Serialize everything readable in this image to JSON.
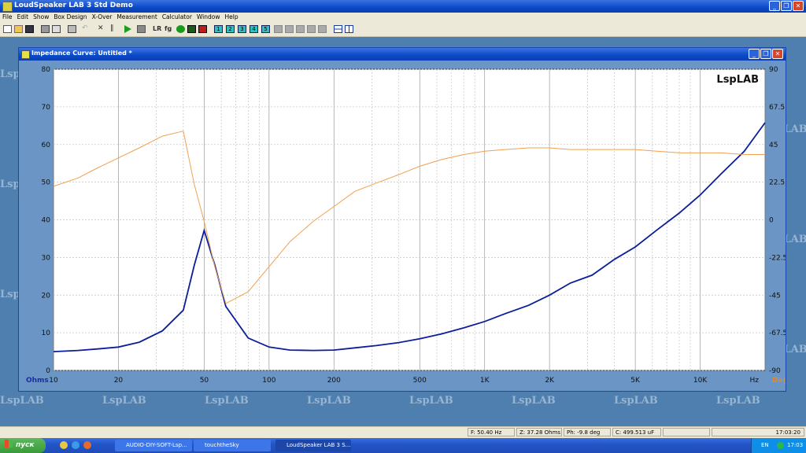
{
  "app": {
    "title": "LoudSpeaker LAB 3 Std Demo",
    "menu": [
      "File",
      "Edit",
      "Show",
      "Box Design",
      "X-Over",
      "Measurement",
      "Calculator",
      "Window",
      "Help"
    ],
    "toolbar_icons": [
      "new-icon",
      "open-icon",
      "save-icon",
      "print-icon",
      "print-preview-icon",
      "copy-icon",
      "undo-icon",
      "tools-icon",
      "sliders-icon",
      "play-icon",
      "stop-icon",
      "lr-icon",
      "fg-icon",
      "green-dot-icon",
      "chart-green-icon",
      "chart-red-icon",
      "num-1-icon",
      "num-2-icon",
      "num-3-icon",
      "num-4-icon",
      "num-5-icon",
      "gray-1-icon",
      "gray-2-icon",
      "gray-3-icon",
      "gray-4-icon",
      "gray-5-icon",
      "gray-6-icon",
      "tile-horizontal-icon",
      "tile-vertical-icon"
    ]
  },
  "window": {
    "title": "Impedance Curve: Untitled *"
  },
  "watermark": "LspLAB",
  "chart_data": {
    "type": "line",
    "title": "LspLAB",
    "xlabel": "Hz",
    "ylabel": "Ohms",
    "y2label": "Deg",
    "x_scale": "log",
    "xlim": [
      10,
      20000
    ],
    "ylim": [
      0,
      80
    ],
    "y2lim": [
      -90,
      90
    ],
    "x_ticks": [
      {
        "v": 10,
        "label": "10"
      },
      {
        "v": 20,
        "label": "20"
      },
      {
        "v": 50,
        "label": "50"
      },
      {
        "v": 100,
        "label": "100"
      },
      {
        "v": 200,
        "label": "200"
      },
      {
        "v": 500,
        "label": "500"
      },
      {
        "v": 1000,
        "label": "1K"
      },
      {
        "v": 2000,
        "label": "2K"
      },
      {
        "v": 5000,
        "label": "5K"
      },
      {
        "v": 10000,
        "label": "10K"
      }
    ],
    "y_ticks": [
      0,
      10,
      20,
      30,
      40,
      50,
      60,
      70,
      80
    ],
    "y2_ticks": [
      "-90",
      "-67.5",
      "-45",
      "-22.5",
      "0",
      "22.5",
      "45",
      "67.5",
      "90"
    ],
    "grid": true,
    "series": [
      {
        "name": "Ohms",
        "color": "#0a1e9a",
        "axis": "left",
        "points": [
          [
            10,
            5
          ],
          [
            13,
            5.3
          ],
          [
            16,
            5.7
          ],
          [
            20,
            6.2
          ],
          [
            25,
            7.5
          ],
          [
            32,
            10.5
          ],
          [
            40,
            16
          ],
          [
            45,
            28
          ],
          [
            50,
            37.2
          ],
          [
            56,
            28
          ],
          [
            63,
            17
          ],
          [
            80,
            8.6
          ],
          [
            100,
            6.2
          ],
          [
            125,
            5.4
          ],
          [
            160,
            5.3
          ],
          [
            200,
            5.4
          ],
          [
            250,
            6
          ],
          [
            315,
            6.6
          ],
          [
            400,
            7.4
          ],
          [
            500,
            8.4
          ],
          [
            630,
            9.7
          ],
          [
            800,
            11.3
          ],
          [
            1000,
            13
          ],
          [
            1250,
            15.1
          ],
          [
            1600,
            17.3
          ],
          [
            2000,
            20
          ],
          [
            2500,
            23.2
          ],
          [
            3150,
            25.3
          ],
          [
            4000,
            29.5
          ],
          [
            5000,
            32.8
          ],
          [
            6300,
            37.3
          ],
          [
            8000,
            41.8
          ],
          [
            10000,
            46.6
          ],
          [
            12500,
            52.2
          ],
          [
            16000,
            58.2
          ],
          [
            20000,
            65.8
          ]
        ]
      },
      {
        "name": "Deg",
        "color": "#f0a050",
        "axis": "right",
        "points": [
          [
            10,
            20
          ],
          [
            13,
            25
          ],
          [
            16,
            31
          ],
          [
            20,
            37
          ],
          [
            25,
            43
          ],
          [
            32,
            50
          ],
          [
            40,
            53
          ],
          [
            45,
            21
          ],
          [
            50,
            -1
          ],
          [
            56,
            -28
          ],
          [
            63,
            -50
          ],
          [
            80,
            -43
          ],
          [
            100,
            -28
          ],
          [
            125,
            -13
          ],
          [
            160,
            -1
          ],
          [
            200,
            8
          ],
          [
            250,
            17
          ],
          [
            315,
            22
          ],
          [
            400,
            27
          ],
          [
            500,
            32
          ],
          [
            630,
            36
          ],
          [
            800,
            39
          ],
          [
            1000,
            41
          ],
          [
            1250,
            42
          ],
          [
            1600,
            43
          ],
          [
            2000,
            43
          ],
          [
            2500,
            42
          ],
          [
            3150,
            42
          ],
          [
            4000,
            42
          ],
          [
            5000,
            42
          ],
          [
            6300,
            41
          ],
          [
            8000,
            40
          ],
          [
            10000,
            40
          ],
          [
            12500,
            40
          ],
          [
            16000,
            39
          ],
          [
            20000,
            39
          ]
        ]
      }
    ]
  },
  "status": {
    "freq": "F: 50.40 Hz",
    "z": "Z: 37.28 Ohms",
    "ph": "Ph: -9.8 deg",
    "c": "C: 499.513 uF",
    "time": "17:03:20"
  },
  "taskbar": {
    "start": "пуск",
    "tasks": [
      "AUDIO-DIY-SOFT-Lsp...",
      "touchtheSky",
      "LoudSpeaker LAB 3 S..."
    ],
    "lang": "EN",
    "clock": "17:03"
  }
}
